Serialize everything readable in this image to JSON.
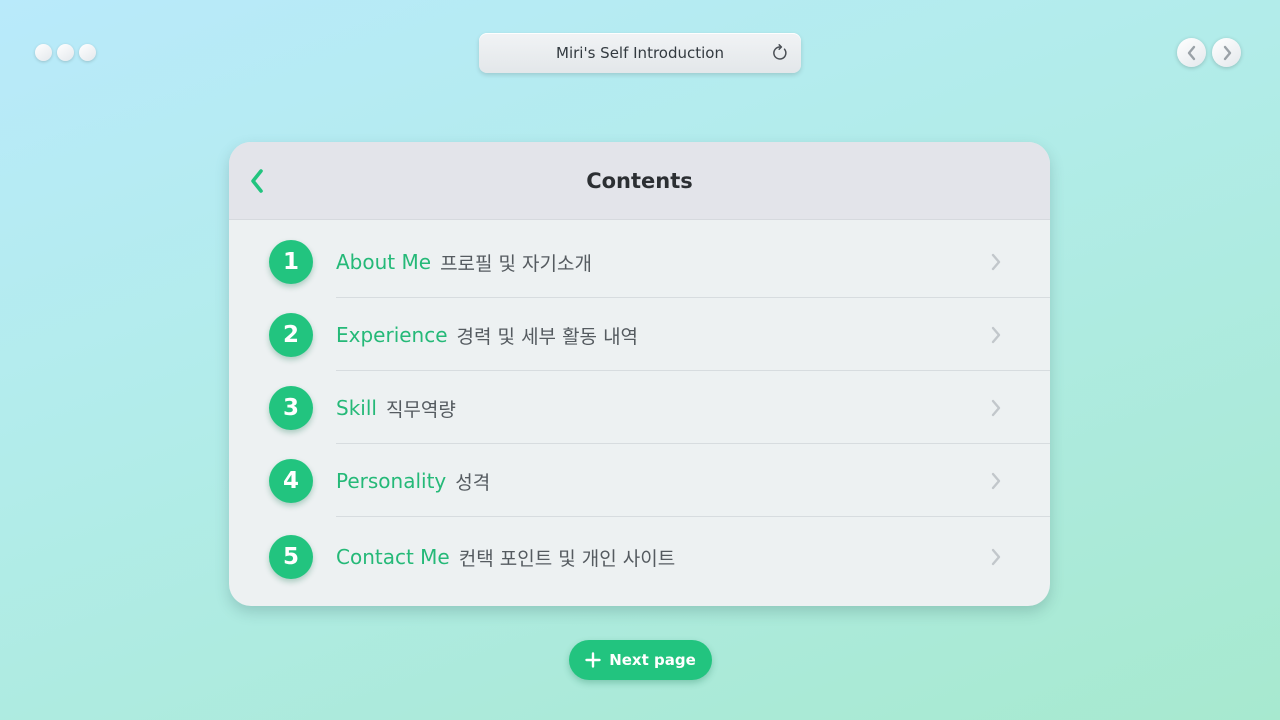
{
  "address_bar": {
    "title": "Miri's Self Introduction",
    "refresh_icon": "refresh-icon"
  },
  "nav": {
    "back_icon": "chevron-left-icon",
    "forward_icon": "chevron-right-icon"
  },
  "card": {
    "title": "Contents",
    "back_icon": "chevron-left-icon",
    "items": [
      {
        "number": "1",
        "en": "About Me",
        "ko": "프로필 및 자기소개"
      },
      {
        "number": "2",
        "en": "Experience",
        "ko": "경력 및 세부 활동 내역"
      },
      {
        "number": "3",
        "en": "Skill",
        "ko": "직무역량"
      },
      {
        "number": "4",
        "en": "Personality",
        "ko": "성격"
      },
      {
        "number": "5",
        "en": "Contact Me",
        "ko": "컨택 포인트 및 개인 사이트"
      }
    ]
  },
  "next_button": {
    "label": "Next page",
    "icon": "plus-icon"
  },
  "colors": {
    "accent": "#22c47f",
    "accent_text": "#25b978",
    "body_text": "#555b60",
    "card_bg": "#edf1f2",
    "header_bg": "#e3e4ea"
  }
}
